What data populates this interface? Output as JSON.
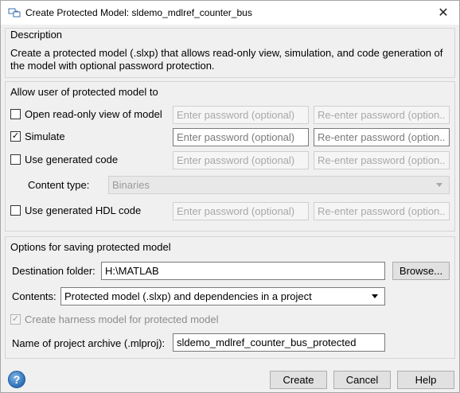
{
  "window": {
    "title": "Create Protected Model: sldemo_mdlref_counter_bus",
    "close_glyph": "✕"
  },
  "description": {
    "heading": "Description",
    "text": "Create a protected model (.slxp) that allows read-only view, simulation, and code generation of the model with optional password protection."
  },
  "permissions": {
    "heading": "Allow user of protected model to",
    "password_placeholder": "Enter password (optional)",
    "reenter_placeholder": "Re-enter password (option...",
    "options": [
      {
        "label": "Open read-only view of model",
        "checked": false
      },
      {
        "label": "Simulate",
        "checked": true
      },
      {
        "label": "Use generated code",
        "checked": false
      },
      {
        "label": "Use generated HDL code",
        "checked": false
      }
    ],
    "content_type_label": "Content type:",
    "content_type_value": "Binaries"
  },
  "saving": {
    "heading": "Options for saving protected model",
    "destination_label": "Destination folder:",
    "destination_value": "H:\\MATLAB",
    "browse_label": "Browse...",
    "contents_label": "Contents:",
    "contents_value": "Protected model (.slxp) and dependencies in a project",
    "harness_label": "Create harness model for protected model",
    "harness_checked": true,
    "archive_label": "Name of project archive (.mlproj):",
    "archive_value": "sldemo_mdlref_counter_bus_protected"
  },
  "footer": {
    "help_glyph": "?",
    "create_label": "Create",
    "cancel_label": "Cancel",
    "help_label": "Help"
  },
  "colors": {
    "dialog_bg": "#f0f0f0",
    "help_icon_blue": "#2d6fb5"
  }
}
